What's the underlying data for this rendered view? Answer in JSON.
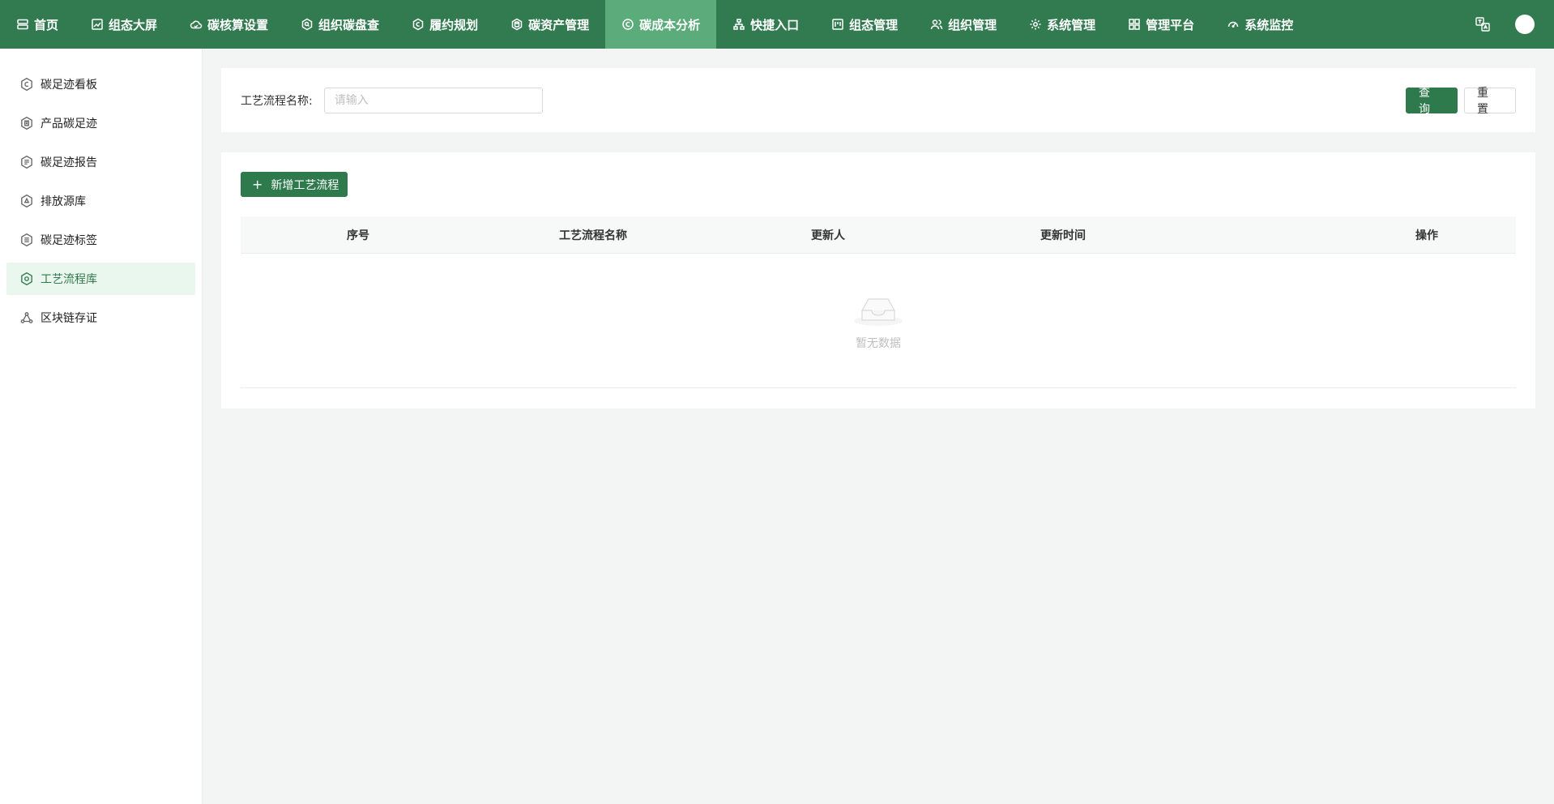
{
  "nav": {
    "items": [
      {
        "label": "首页",
        "icon": "server-icon"
      },
      {
        "label": "组态大屏",
        "icon": "chart-line-icon"
      },
      {
        "label": "碳核算设置",
        "icon": "cloud-icon"
      },
      {
        "label": "组织碳盘查",
        "icon": "hex-search-icon"
      },
      {
        "label": "履约规划",
        "icon": "hex-c-icon"
      },
      {
        "label": "碳资产管理",
        "icon": "hex-db-icon"
      },
      {
        "label": "碳成本分析",
        "icon": "circle-c-icon"
      },
      {
        "label": "快捷入口",
        "icon": "org-tree-icon"
      },
      {
        "label": "组态管理",
        "icon": "kanban-icon"
      },
      {
        "label": "组织管理",
        "icon": "users-icon"
      },
      {
        "label": "系统管理",
        "icon": "gear-icon"
      },
      {
        "label": "管理平台",
        "icon": "grid-icon"
      },
      {
        "label": "系统监控",
        "icon": "gauge-icon"
      }
    ],
    "active_index": 6
  },
  "sidebar": {
    "items": [
      {
        "label": "碳足迹看板",
        "icon": "hex-c-icon"
      },
      {
        "label": "产品碳足迹",
        "icon": "hex-doc-icon"
      },
      {
        "label": "碳足迹报告",
        "icon": "hex-report-icon"
      },
      {
        "label": "排放源库",
        "icon": "hex-recycle-icon"
      },
      {
        "label": "碳足迹标签",
        "icon": "hex-list-icon"
      },
      {
        "label": "工艺流程库",
        "icon": "hex-flow-icon"
      },
      {
        "label": "区块链存证",
        "icon": "blockchain-icon"
      }
    ],
    "active_index": 5
  },
  "search": {
    "label": "工艺流程名称:",
    "placeholder": "请输入",
    "value": "",
    "query_label": "查 询",
    "reset_label": "重 置"
  },
  "table": {
    "add_label": "新增工艺流程",
    "columns": [
      "序号",
      "工艺流程名称",
      "更新人",
      "更新时间",
      "操作"
    ],
    "rows": [],
    "empty_text": "暂无数据"
  },
  "colors": {
    "primary": "#2f7a4c",
    "nav_bg": "#327a4f",
    "nav_active": "#5cab7a",
    "sidebar_active_bg": "#eaf7ef"
  }
}
